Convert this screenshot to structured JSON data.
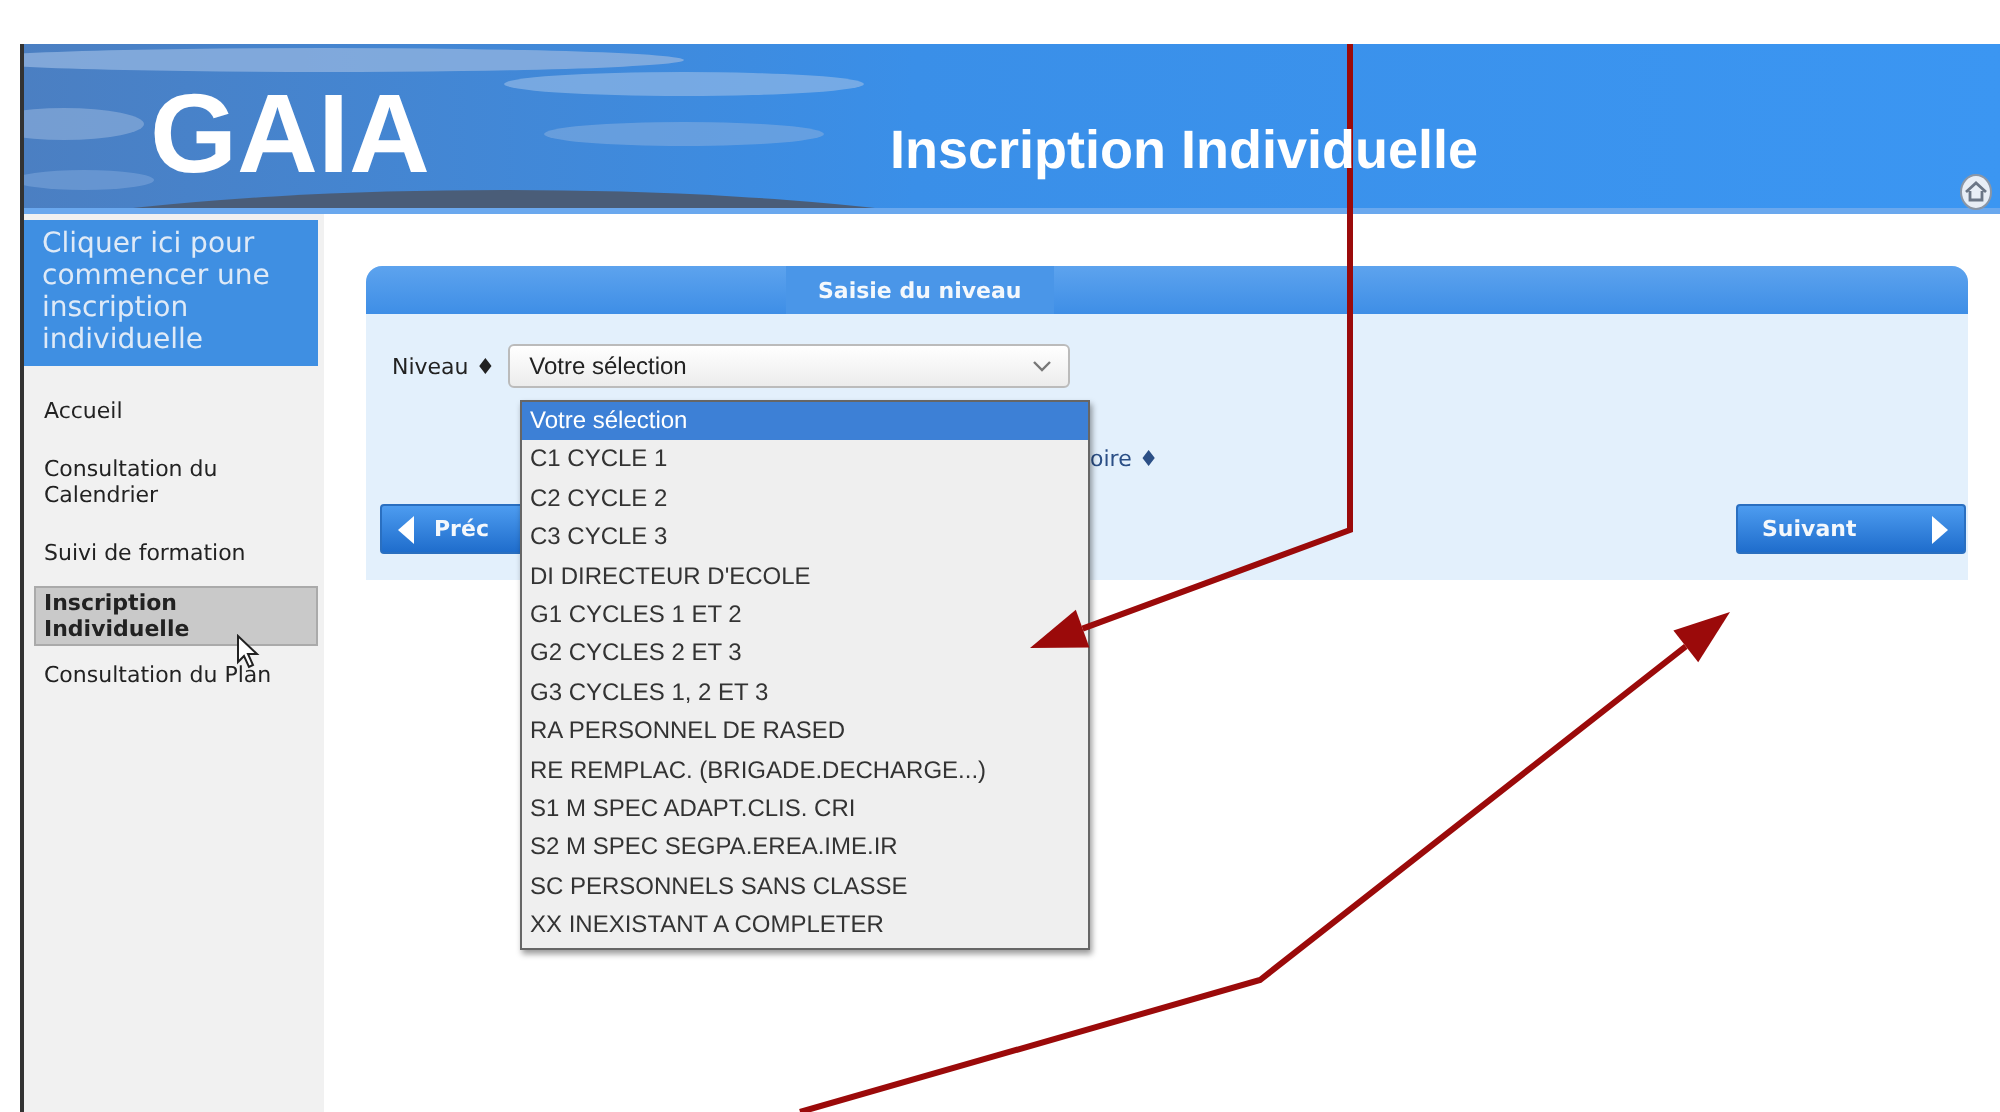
{
  "header": {
    "logo": "GAIA",
    "title": "Inscription Individuelle"
  },
  "sidebar": {
    "banner": "Cliquer ici pour commencer une inscription individuelle",
    "items": [
      {
        "label": "Accueil",
        "selected": false
      },
      {
        "label": "Consultation du Calendrier",
        "selected": false
      },
      {
        "label": "Suivi de formation",
        "selected": false
      },
      {
        "label": "Inscription Individuelle",
        "selected": true
      },
      {
        "label": "Consultation du Plan",
        "selected": false
      }
    ]
  },
  "panel": {
    "tab": "Saisie du niveau",
    "field_label": "Niveau ♦",
    "select_value": "Votre sélection",
    "partial_label": "oire ♦",
    "options": [
      {
        "label": "Votre sélection",
        "selected": true
      },
      {
        "label": "C1 CYCLE 1",
        "selected": false
      },
      {
        "label": "C2 CYCLE 2",
        "selected": false
      },
      {
        "label": "C3 CYCLE 3",
        "selected": false
      },
      {
        "label": "DI DIRECTEUR D'ECOLE",
        "selected": false
      },
      {
        "label": "G1 CYCLES 1 ET 2",
        "selected": false
      },
      {
        "label": "G2 CYCLES 2 ET 3",
        "selected": false
      },
      {
        "label": "G3 CYCLES 1, 2 ET 3",
        "selected": false
      },
      {
        "label": "RA PERSONNEL DE RASED",
        "selected": false
      },
      {
        "label": "RE REMPLAC. (BRIGADE.DECHARGE...)",
        "selected": false
      },
      {
        "label": "S1 M SPEC ADAPT.CLIS. CRI",
        "selected": false
      },
      {
        "label": "S2 M SPEC SEGPA.EREA.IME.IR",
        "selected": false
      },
      {
        "label": "SC PERSONNELS SANS CLASSE",
        "selected": false
      },
      {
        "label": "XX INEXISTANT A COMPLETER",
        "selected": false
      }
    ],
    "buttons": [
      {
        "label": "Préc",
        "kind": "previous"
      },
      {
        "label": "Suivant",
        "kind": "next"
      }
    ]
  }
}
